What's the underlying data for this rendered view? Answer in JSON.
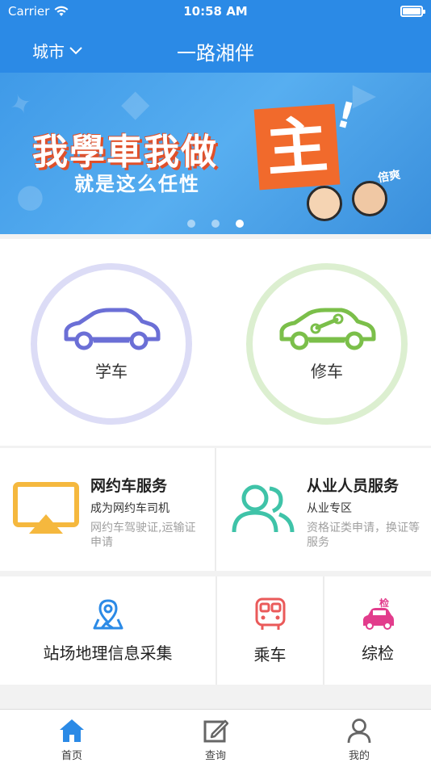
{
  "status_bar": {
    "carrier": "Carrier",
    "time": "10:58 AM"
  },
  "nav": {
    "city_label": "城市",
    "title": "一路湘伴"
  },
  "banner": {
    "headline": "我學車我做",
    "headline_char": "主",
    "headline_exclaim": "!",
    "subline": "就是这么任性",
    "promo": "倍爽",
    "slide_count": 3,
    "active_slide": 3
  },
  "modules": [
    {
      "label": "学车",
      "icon": "car-icon",
      "color": "#6b6fd6"
    },
    {
      "label": "修车",
      "icon": "car-wrench-icon",
      "color": "#7bbf4a"
    }
  ],
  "services": [
    {
      "title": "网约车服务",
      "subtitle": "成为网约车司机",
      "desc": "网约车驾驶证,运输证申请",
      "icon": "airplay-icon",
      "color": "#f5b83e"
    },
    {
      "title": "从业人员服务",
      "subtitle": "从业专区",
      "desc": "资格证类申请，换证等服务",
      "icon": "people-icon",
      "color": "#3fc3a8"
    }
  ],
  "tools": [
    {
      "label": "站场地理信息采集",
      "icon": "map-pin-icon",
      "color": "#2b8ae6"
    },
    {
      "label": "乘车",
      "icon": "bus-icon",
      "color": "#ea5a5a"
    },
    {
      "label": "综检",
      "icon": "car-inspection-icon",
      "color": "#e23c8c",
      "badge": "检"
    }
  ],
  "tabbar": [
    {
      "label": "首页",
      "icon": "home-icon",
      "active": true
    },
    {
      "label": "查询",
      "icon": "edit-icon",
      "active": false
    },
    {
      "label": "我的",
      "icon": "user-icon",
      "active": false
    }
  ],
  "colors": {
    "primary": "#2b8ae6",
    "active_tab": "#2b8ae6",
    "inactive_tab": "#666666"
  }
}
